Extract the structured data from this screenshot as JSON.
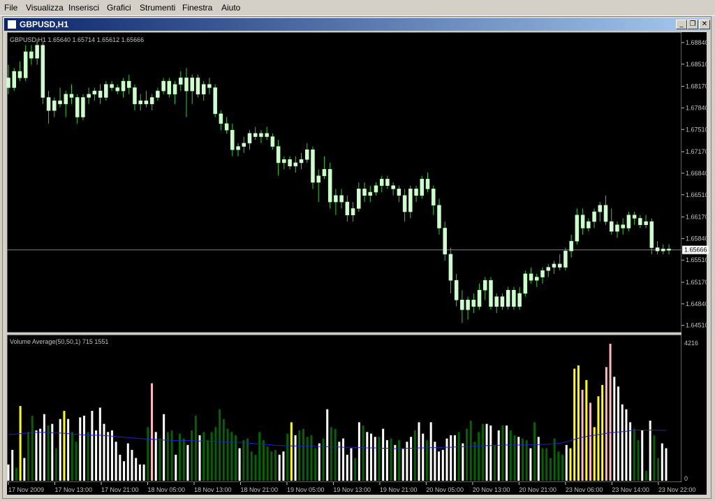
{
  "menu": [
    {
      "label": "File",
      "x": 6
    },
    {
      "label": "Visualizza",
      "x": 37
    },
    {
      "label": "Inserisci",
      "x": 98
    },
    {
      "label": "Grafici",
      "x": 153
    },
    {
      "label": "Strumenti",
      "x": 200
    },
    {
      "label": "Finestra",
      "x": 261
    },
    {
      "label": "Aiuto",
      "x": 317
    }
  ],
  "window": {
    "title": "GBPUSD,H1",
    "buttons": {
      "minimize": "_",
      "restore": "❐",
      "close": "✕"
    }
  },
  "colors": {
    "background": "#000000",
    "candle": "#ccffcc",
    "wick": "#33cc33",
    "volume_green": "#006400",
    "volume_white": "#ffffff",
    "volume_yellow": "#ffff00",
    "volume_pink": "#ffb6c1",
    "average_line": "#1f1fd6",
    "price_line": "#808080"
  },
  "chart_data": [
    {
      "type": "candlestick",
      "title": "GBPUSD,H1",
      "ohlc_label": "1.65640 1.65714 1.65612 1.65666",
      "ylim": [
        1.644,
        1.69
      ],
      "yticks": [
        "1.68840",
        "1.68510",
        "1.68170",
        "1.67840",
        "1.67510",
        "1.67170",
        "1.66840",
        "1.66510",
        "1.66170",
        "1.65840",
        "1.65510",
        "1.65170",
        "1.64840",
        "1.64510"
      ],
      "current_price": "1.65666",
      "current_value": 1.65666,
      "candles": [
        [
          1.683,
          1.685,
          1.6805,
          1.6815
        ],
        [
          1.6815,
          1.6845,
          1.681,
          1.684
        ],
        [
          1.684,
          1.6855,
          1.6825,
          1.683
        ],
        [
          1.683,
          1.688,
          1.6825,
          1.687
        ],
        [
          1.687,
          1.688,
          1.685,
          1.686
        ],
        [
          1.686,
          1.689,
          1.685,
          1.688
        ],
        [
          1.688,
          1.6885,
          1.679,
          1.68
        ],
        [
          1.68,
          1.681,
          1.676,
          1.678
        ],
        [
          1.678,
          1.68,
          1.677,
          1.6795
        ],
        [
          1.6795,
          1.6815,
          1.6785,
          1.679
        ],
        [
          1.679,
          1.681,
          1.677,
          1.6805
        ],
        [
          1.6805,
          1.682,
          1.679,
          1.68
        ],
        [
          1.68,
          1.6805,
          1.676,
          1.677
        ],
        [
          1.677,
          1.6805,
          1.6765,
          1.68
        ],
        [
          1.68,
          1.6815,
          1.679,
          1.6805
        ],
        [
          1.6805,
          1.6815,
          1.6795,
          1.681
        ],
        [
          1.681,
          1.682,
          1.679,
          1.68
        ],
        [
          1.68,
          1.6825,
          1.6795,
          1.682
        ],
        [
          1.682,
          1.6825,
          1.681,
          1.6815
        ],
        [
          1.6815,
          1.682,
          1.6805,
          1.681
        ],
        [
          1.681,
          1.683,
          1.68,
          1.6825
        ],
        [
          1.6825,
          1.6835,
          1.6805,
          1.6815
        ],
        [
          1.6815,
          1.682,
          1.678,
          1.679
        ],
        [
          1.679,
          1.6805,
          1.678,
          1.6795
        ],
        [
          1.6795,
          1.681,
          1.6785,
          1.679
        ],
        [
          1.679,
          1.6805,
          1.678,
          1.68
        ],
        [
          1.68,
          1.6815,
          1.6795,
          1.681
        ],
        [
          1.681,
          1.683,
          1.6805,
          1.6825
        ],
        [
          1.6825,
          1.683,
          1.68,
          1.6805
        ],
        [
          1.6805,
          1.6825,
          1.679,
          1.682
        ],
        [
          1.682,
          1.684,
          1.681,
          1.683
        ],
        [
          1.683,
          1.6845,
          1.677,
          1.681
        ],
        [
          1.681,
          1.6835,
          1.679,
          1.683
        ],
        [
          1.683,
          1.6835,
          1.68,
          1.6805
        ],
        [
          1.6805,
          1.6825,
          1.6795,
          1.682
        ],
        [
          1.682,
          1.683,
          1.6805,
          1.6815
        ],
        [
          1.6815,
          1.682,
          1.677,
          1.6775
        ],
        [
          1.6775,
          1.678,
          1.675,
          1.676
        ],
        [
          1.676,
          1.677,
          1.6745,
          1.675
        ],
        [
          1.675,
          1.676,
          1.671,
          1.672
        ],
        [
          1.672,
          1.673,
          1.671,
          1.6725
        ],
        [
          1.6725,
          1.674,
          1.6715,
          1.673
        ],
        [
          1.673,
          1.675,
          1.672,
          1.6745
        ],
        [
          1.6745,
          1.6755,
          1.6735,
          1.674
        ],
        [
          1.674,
          1.675,
          1.673,
          1.6745
        ],
        [
          1.6745,
          1.6755,
          1.6735,
          1.674
        ],
        [
          1.674,
          1.6745,
          1.672,
          1.6725
        ],
        [
          1.6725,
          1.6735,
          1.668,
          1.67
        ],
        [
          1.67,
          1.671,
          1.669,
          1.6705
        ],
        [
          1.6705,
          1.671,
          1.669,
          1.6695
        ],
        [
          1.6695,
          1.671,
          1.6685,
          1.67
        ],
        [
          1.67,
          1.6715,
          1.669,
          1.6705
        ],
        [
          1.6705,
          1.673,
          1.67,
          1.672
        ],
        [
          1.672,
          1.6725,
          1.666,
          1.667
        ],
        [
          1.667,
          1.669,
          1.664,
          1.668
        ],
        [
          1.668,
          1.671,
          1.6675,
          1.669
        ],
        [
          1.669,
          1.67,
          1.663,
          1.664
        ],
        [
          1.664,
          1.666,
          1.662,
          1.665
        ],
        [
          1.665,
          1.666,
          1.663,
          1.664
        ],
        [
          1.664,
          1.665,
          1.661,
          1.662
        ],
        [
          1.662,
          1.664,
          1.661,
          1.663
        ],
        [
          1.663,
          1.667,
          1.6625,
          1.666
        ],
        [
          1.666,
          1.667,
          1.664,
          1.665
        ],
        [
          1.665,
          1.6665,
          1.664,
          1.6655
        ],
        [
          1.6655,
          1.667,
          1.665,
          1.6665
        ],
        [
          1.6665,
          1.668,
          1.6655,
          1.6675
        ],
        [
          1.6675,
          1.668,
          1.666,
          1.6665
        ],
        [
          1.6665,
          1.667,
          1.665,
          1.666
        ],
        [
          1.666,
          1.6665,
          1.664,
          1.665
        ],
        [
          1.665,
          1.666,
          1.661,
          1.6625
        ],
        [
          1.6625,
          1.6665,
          1.6615,
          1.666
        ],
        [
          1.666,
          1.6665,
          1.664,
          1.665
        ],
        [
          1.665,
          1.668,
          1.6645,
          1.6675
        ],
        [
          1.6675,
          1.6685,
          1.6655,
          1.666
        ],
        [
          1.666,
          1.6665,
          1.662,
          1.6635
        ],
        [
          1.6635,
          1.6645,
          1.659,
          1.66
        ],
        [
          1.66,
          1.661,
          1.655,
          1.656
        ],
        [
          1.656,
          1.657,
          1.65,
          1.652
        ],
        [
          1.652,
          1.653,
          1.648,
          1.649
        ],
        [
          1.649,
          1.6505,
          1.6455,
          1.6475
        ],
        [
          1.6475,
          1.6495,
          1.646,
          1.649
        ],
        [
          1.649,
          1.65,
          1.647,
          1.648
        ],
        [
          1.648,
          1.6515,
          1.6475,
          1.6505
        ],
        [
          1.6505,
          1.6525,
          1.649,
          1.652
        ],
        [
          1.652,
          1.6525,
          1.6475,
          1.648
        ],
        [
          1.648,
          1.65,
          1.647,
          1.6495
        ],
        [
          1.6495,
          1.65,
          1.6475,
          1.648
        ],
        [
          1.648,
          1.651,
          1.6475,
          1.6505
        ],
        [
          1.6505,
          1.651,
          1.6475,
          1.648
        ],
        [
          1.648,
          1.651,
          1.6475,
          1.65
        ],
        [
          1.65,
          1.6535,
          1.6495,
          1.653
        ],
        [
          1.653,
          1.654,
          1.6515,
          1.652
        ],
        [
          1.652,
          1.653,
          1.651,
          1.6525
        ],
        [
          1.6525,
          1.654,
          1.6515,
          1.6535
        ],
        [
          1.6535,
          1.6545,
          1.6525,
          1.654
        ],
        [
          1.654,
          1.655,
          1.653,
          1.6545
        ],
        [
          1.6545,
          1.656,
          1.6535,
          1.654
        ],
        [
          1.654,
          1.657,
          1.6535,
          1.6565
        ],
        [
          1.6565,
          1.659,
          1.6555,
          1.658
        ],
        [
          1.658,
          1.663,
          1.6575,
          1.662
        ],
        [
          1.662,
          1.663,
          1.659,
          1.66
        ],
        [
          1.66,
          1.6615,
          1.6595,
          1.661
        ],
        [
          1.661,
          1.663,
          1.66,
          1.6625
        ],
        [
          1.6625,
          1.664,
          1.661,
          1.6635
        ],
        [
          1.6635,
          1.665,
          1.6605,
          1.661
        ],
        [
          1.661,
          1.663,
          1.659,
          1.6595
        ],
        [
          1.6595,
          1.661,
          1.6585,
          1.6605
        ],
        [
          1.6605,
          1.6615,
          1.659,
          1.66
        ],
        [
          1.66,
          1.6625,
          1.6595,
          1.662
        ],
        [
          1.662,
          1.6625,
          1.6605,
          1.6615
        ],
        [
          1.6615,
          1.662,
          1.66,
          1.6605
        ],
        [
          1.6605,
          1.662,
          1.66,
          1.661
        ],
        [
          1.661,
          1.6615,
          1.656,
          1.657
        ],
        [
          1.657,
          1.658,
          1.656,
          1.6565
        ],
        [
          1.6565,
          1.6575,
          1.656,
          1.6568
        ],
        [
          1.6568,
          1.6575,
          1.656,
          1.6566
        ]
      ],
      "xticks": [
        "17 Nov 2009",
        "17 Nov 13:00",
        "17 Nov 21:00",
        "18 Nov 05:00",
        "18 Nov 13:00",
        "18 Nov 21:00",
        "19 Nov 05:00",
        "19 Nov 13:00",
        "19 Nov 21:00",
        "20 Nov 05:00",
        "20 Nov 13:00",
        "20 Nov 21:00",
        "23 Nov 06:00",
        "23 Nov 14:00",
        "23 Nov 22:00"
      ]
    },
    {
      "type": "bar",
      "title": "Volume Average(50,50,1) 715 1551",
      "ylim": [
        0,
        4216
      ],
      "yticks": [
        "4216",
        "0"
      ],
      "values": [
        500,
        950,
        400,
        2300,
        700,
        1500,
        2000,
        1550,
        1600,
        2050,
        1700,
        1750,
        1000,
        1900,
        2150,
        1900,
        1500,
        1200,
        1950,
        2000,
        1500,
        2150,
        1550,
        2250,
        1750,
        1500,
        1550,
        1200,
        800,
        600,
        1150,
        950,
        700,
        500,
        500,
        1650,
        3000,
        1500,
        1300,
        2050,
        1500,
        1550,
        800,
        1450,
        1300,
        1100,
        1550,
        2000,
        1400,
        1500,
        1250,
        1500,
        1650,
        2200,
        1900,
        1600,
        1500,
        1400,
        1000,
        1250,
        1300,
        900,
        800,
        1500,
        1250,
        1050,
        900,
        950,
        800,
        900,
        1450,
        1800,
        1400,
        1550,
        1600,
        1350,
        1400,
        1000,
        1150,
        1300,
        2200,
        1650,
        1600,
        1200,
        1300,
        800,
        1000,
        700,
        1800,
        1700,
        1500,
        1450,
        1350,
        1350,
        1600,
        1250,
        1300,
        1100,
        1250,
        1000,
        1200,
        1350,
        1550,
        1800,
        1450,
        1250,
        1800,
        1200,
        900,
        950,
        1300,
        1400,
        1400,
        1500,
        1150,
        1600,
        1850,
        1200,
        1500,
        1750,
        1750,
        1700,
        1100,
        1550,
        1700,
        1700,
        1550,
        1400,
        1350,
        1300,
        1250,
        1000,
        1800,
        1350,
        1000,
        1000,
        700,
        1300,
        900,
        800,
        1100,
        1000,
        3450,
        3550,
        2800,
        3100,
        2400,
        1650,
        2600,
        2950,
        3500,
        4216,
        3200,
        2900,
        2350,
        2200,
        1800,
        1600,
        1250,
        1550,
        300,
        1850,
        1400,
        700,
        1150,
        1000
      ],
      "colors": [
        "w",
        "w",
        "g",
        "y",
        "w",
        "g",
        "g",
        "w",
        "w",
        "w",
        "g",
        "w",
        "g",
        "w",
        "y",
        "w",
        "g",
        "g",
        "w",
        "w",
        "g",
        "w",
        "w",
        "w",
        "w",
        "w",
        "w",
        "w",
        "w",
        "w",
        "w",
        "w",
        "w",
        "w",
        "w",
        "g",
        "p",
        "w",
        "g",
        "w",
        "g",
        "g",
        "w",
        "g",
        "g",
        "w",
        "g",
        "g",
        "w",
        "g",
        "g",
        "g",
        "g",
        "g",
        "g",
        "g",
        "g",
        "g",
        "w",
        "g",
        "g",
        "g",
        "g",
        "g",
        "g",
        "g",
        "g",
        "g",
        "w",
        "w",
        "g",
        "y",
        "w",
        "g",
        "g",
        "g",
        "g",
        "g",
        "w",
        "g",
        "w",
        "g",
        "g",
        "w",
        "w",
        "w",
        "w",
        "g",
        "w",
        "g",
        "w",
        "w",
        "w",
        "g",
        "w",
        "w",
        "g",
        "w",
        "g",
        "w",
        "w",
        "w",
        "g",
        "w",
        "w",
        "g",
        "w",
        "w",
        "w",
        "w",
        "w",
        "w",
        "w",
        "g",
        "w",
        "g",
        "g",
        "g",
        "g",
        "g",
        "w",
        "w",
        "g",
        "w",
        "g",
        "w",
        "g",
        "g",
        "w",
        "g",
        "g",
        "w",
        "g",
        "w",
        "g",
        "g",
        "g",
        "g",
        "g",
        "g",
        "w",
        "y",
        "y",
        "y",
        "p",
        "y",
        "p",
        "y",
        "y",
        "y",
        "p",
        "p",
        "w",
        "w",
        "w",
        "w",
        "w",
        "g",
        "g",
        "w",
        "g",
        "w",
        "g",
        "g",
        "w"
      ],
      "average": [
        1420,
        1430,
        1440,
        1450,
        1460,
        1470,
        1480,
        1490,
        1490,
        1490,
        1490,
        1480,
        1480,
        1470,
        1460,
        1450,
        1440,
        1430,
        1420,
        1410,
        1410,
        1400,
        1400,
        1400,
        1390,
        1380,
        1370,
        1360,
        1350,
        1340,
        1330,
        1320,
        1310,
        1300,
        1290,
        1280,
        1280,
        1270,
        1260,
        1250,
        1250,
        1240,
        1240,
        1240,
        1240,
        1230,
        1230,
        1230,
        1220,
        1220,
        1220,
        1210,
        1210,
        1200,
        1200,
        1190,
        1190,
        1180,
        1180,
        1170,
        1160,
        1150,
        1140,
        1130,
        1120,
        1110,
        1100,
        1090,
        1080,
        1080,
        1070,
        1070,
        1070,
        1070,
        1060,
        1060,
        1060,
        1060,
        1050,
        1050,
        1050,
        1040,
        1040,
        1040,
        1030,
        1030,
        1030,
        1020,
        1020,
        1020,
        1010,
        1010,
        1010,
        1000,
        1000,
        1000,
        1000,
        990,
        990,
        990,
        1000,
        1000,
        1000,
        1010,
        1010,
        1010,
        1020,
        1020,
        1020,
        1030,
        1030,
        1030,
        1040,
        1040,
        1050,
        1050,
        1060,
        1060,
        1070,
        1070,
        1080,
        1080,
        1090,
        1090,
        1090,
        1100,
        1100,
        1100,
        1100,
        1100,
        1100,
        1110,
        1110,
        1110,
        1120,
        1120,
        1130,
        1140,
        1150,
        1170,
        1200,
        1230,
        1270,
        1310,
        1340,
        1360,
        1380,
        1400,
        1420,
        1440,
        1460,
        1480,
        1490,
        1500,
        1510,
        1520,
        1540,
        1550,
        1560,
        1560,
        1560,
        1560,
        1560,
        1555,
        1550,
        1551
      ]
    }
  ]
}
